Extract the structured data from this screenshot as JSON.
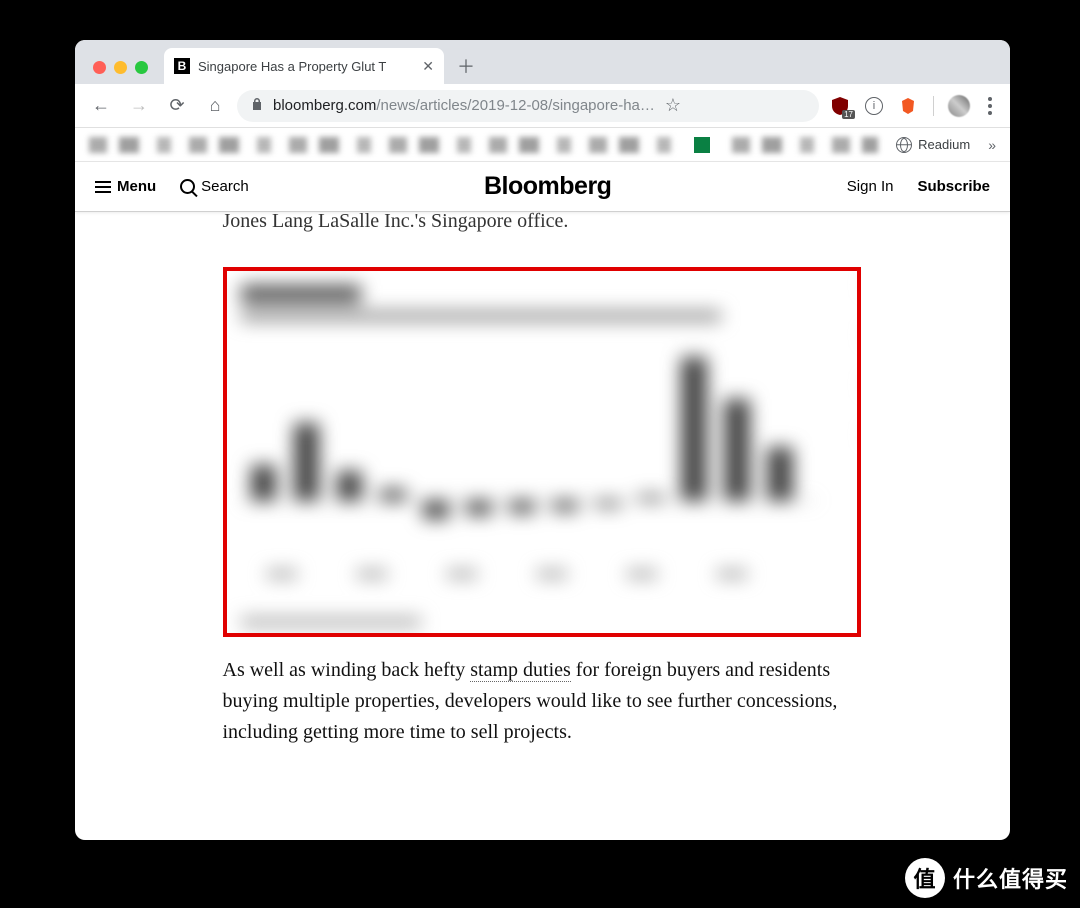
{
  "browser": {
    "tab": {
      "favicon_letter": "B",
      "title": "Singapore Has a Property Glut T"
    },
    "url_domain": "bloomberg.com",
    "url_path": "/news/articles/2019-12-08/singapore-ha…",
    "ublock_count": "17",
    "bookmarks": {
      "readium": "Readium"
    }
  },
  "site": {
    "menu_label": "Menu",
    "search_label": "Search",
    "brand": "Bloomberg",
    "sign_in": "Sign In",
    "subscribe": "Subscribe"
  },
  "article": {
    "partial_line": "Jones Lang LaSalle Inc.'s Singapore office.",
    "paragraph_pre": "As well as winding back hefty ",
    "link_text": "stamp duties",
    "paragraph_post": " for foreign buyers and residents buying multiple properties, developers would like to see further concessions, including getting more time to sell projects."
  },
  "watermark": {
    "badge": "值",
    "text": "什么值得买"
  },
  "chart_data": {
    "type": "bar",
    "note": "Chart pixels are intentionally blurred in source; values approximate relative bar heights only (arbitrary units, baseline=0).",
    "title": "(blurred)",
    "subtitle": "(blurred)",
    "categories": [
      "c1",
      "c2",
      "c3",
      "c4",
      "c5",
      "c6",
      "c7",
      "c8",
      "c9",
      "c10",
      "c11",
      "c12",
      "c13"
    ],
    "values": [
      30,
      65,
      25,
      10,
      -15,
      -12,
      -10,
      -8,
      -5,
      5,
      120,
      85,
      45
    ],
    "ylim": [
      -20,
      130
    ]
  }
}
